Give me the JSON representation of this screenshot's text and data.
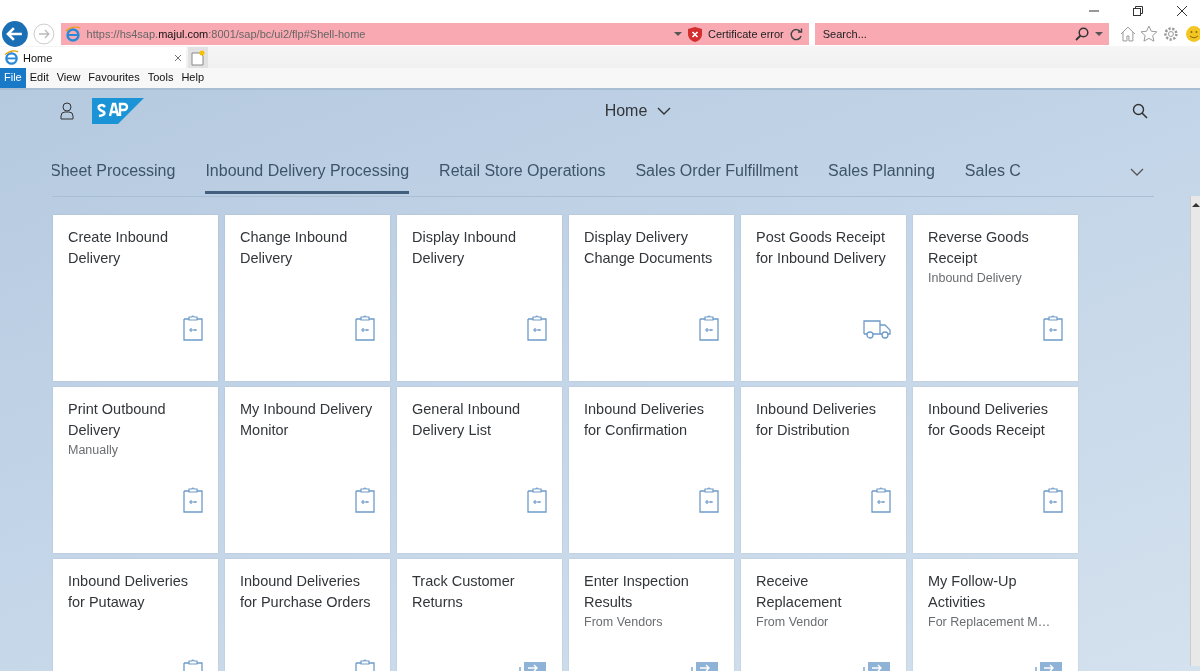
{
  "browser": {
    "address": "https://hs4sap.**majul.com**:8001/sap/bc/ui2/flp#Shell-home",
    "certificate_error": "Certificate error",
    "search": {
      "placeholder": "Search..."
    },
    "tab": {
      "label": "Home"
    },
    "menu": [
      {
        "label": "File",
        "selected": true
      },
      {
        "label": "Edit",
        "selected": false
      },
      {
        "label": "View",
        "selected": false
      },
      {
        "label": "Favourites",
        "selected": false
      },
      {
        "label": "Tools",
        "selected": false
      },
      {
        "label": "Help",
        "selected": false
      }
    ]
  },
  "shell": {
    "title": "Home",
    "groups": [
      {
        "label": "Sheet Processing",
        "selected": false
      },
      {
        "label": "Inbound Delivery Processing",
        "selected": true
      },
      {
        "label": "Retail Store Operations",
        "selected": false
      },
      {
        "label": "Sales Order Fulfillment",
        "selected": false
      },
      {
        "label": "Sales Planning",
        "selected": false
      },
      {
        "label": "Sales C",
        "selected": false
      }
    ],
    "tiles": [
      {
        "title": "Create Inbound Delivery",
        "kind": "clipboard"
      },
      {
        "title": "Change Inbound Delivery",
        "kind": "clipboard"
      },
      {
        "title": "Display Inbound Delivery",
        "kind": "clipboard"
      },
      {
        "title": "Display Delivery Change Documents",
        "kind": "clipboard"
      },
      {
        "title": "Post Goods Receipt for Inbound Delivery",
        "kind": "truck"
      },
      {
        "title": "Reverse Goods Receipt",
        "subtitle": "Inbound Delivery",
        "kind": "clipboard"
      },
      {
        "title": "Print Outbound Delivery",
        "subtitle": "Manually",
        "kind": "clipboard"
      },
      {
        "title": "My Inbound Delivery Monitor",
        "kind": "clipboard"
      },
      {
        "title": "General Inbound Delivery List",
        "kind": "clipboard"
      },
      {
        "title": "Inbound Deliveries for Confirmation",
        "kind": "clipboard"
      },
      {
        "title": "Inbound Deliveries for Distribution",
        "kind": "clipboard"
      },
      {
        "title": "Inbound Deliveries for Goods Receipt",
        "kind": "clipboard"
      },
      {
        "title": "Inbound Deliveries for Putaway",
        "kind": "clipboard"
      },
      {
        "title": "Inbound Deliveries for Purchase Orders",
        "kind": "clipboard"
      },
      {
        "title": "Track Customer Returns",
        "kind": "transfer"
      },
      {
        "title": "Enter Inspection Results",
        "subtitle": "From Vendors",
        "kind": "transfer"
      },
      {
        "title": "Receive Replacement",
        "subtitle": "From Vendor",
        "kind": "transfer"
      },
      {
        "title": "My Follow-Up Activities",
        "subtitle": "For Replacement M…",
        "kind": "transfer"
      }
    ]
  }
}
